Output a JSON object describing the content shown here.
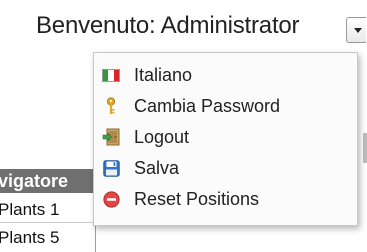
{
  "header": {
    "welcome_text": "Benvenuto: Administrator"
  },
  "grid": {
    "header_label": "vigatore",
    "rows": [
      "Plants 1",
      "Plants 5"
    ]
  },
  "menu": {
    "items": [
      {
        "label": "Italiano",
        "icon": "italian-flag-icon"
      },
      {
        "label": "Cambia Password",
        "icon": "key-icon"
      },
      {
        "label": "Logout",
        "icon": "logout-door-icon"
      },
      {
        "label": "Salva",
        "icon": "save-floppy-icon"
      },
      {
        "label": "Reset Positions",
        "icon": "reset-circle-icon"
      }
    ]
  },
  "colors": {
    "flag_green": "#2e9a3a",
    "flag_white": "#ffffff",
    "flag_red": "#d6262a",
    "key": "#e1a82b",
    "save": "#2f78c7",
    "reset": "#e04848",
    "grid_header": "#6f6f6f"
  }
}
